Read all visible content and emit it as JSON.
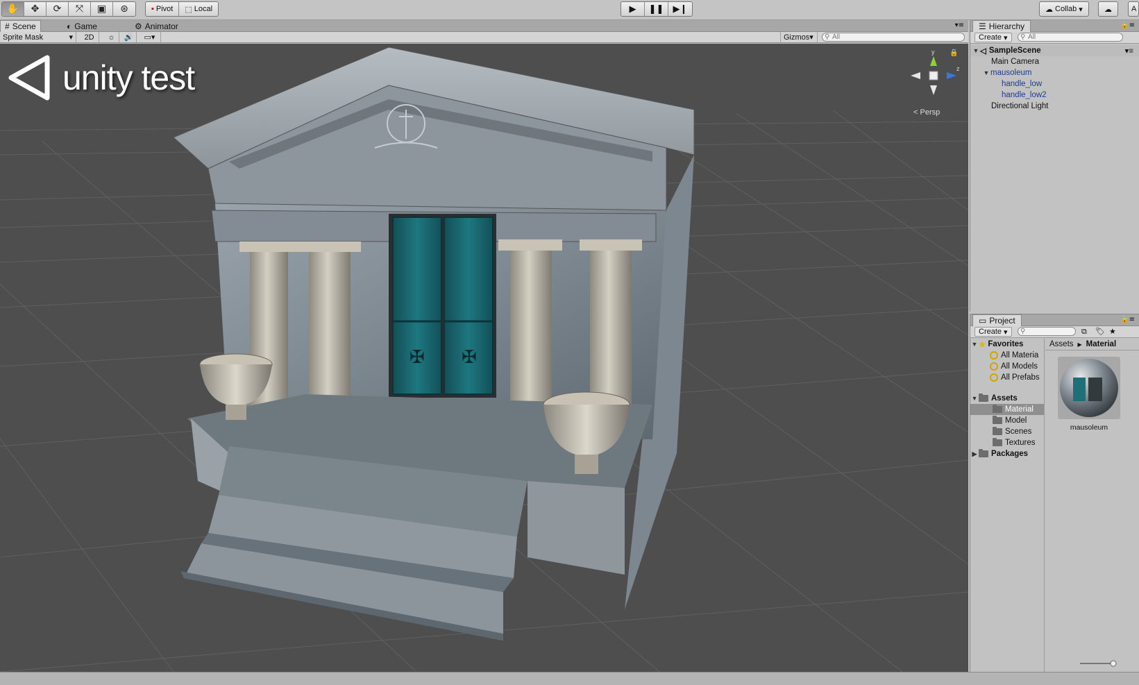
{
  "toolbar": {
    "pivot_label": "Pivot",
    "local_label": "Local",
    "collab_label": "Collab",
    "account_initial": "A"
  },
  "scene_panel": {
    "tabs": [
      {
        "label": "Scene"
      },
      {
        "label": "Game"
      },
      {
        "label": "Animator"
      }
    ],
    "draw_mode": "Sprite Mask",
    "mode_2d": "2D",
    "gizmos_label": "Gizmos",
    "search_placeholder": "All",
    "logo_text": "unity test",
    "gizmo_axes": {
      "y": "y",
      "z": "z"
    },
    "projection_label": "Persp"
  },
  "hierarchy": {
    "tab_label": "Hierarchy",
    "create_label": "Create",
    "search_placeholder": "All",
    "scene_name": "SampleScene",
    "items": [
      {
        "label": "Main Camera"
      },
      {
        "label": "mausoleum"
      },
      {
        "label": "handle_low"
      },
      {
        "label": "handle_low2"
      },
      {
        "label": "Directional Light"
      }
    ]
  },
  "project": {
    "tab_label": "Project",
    "create_label": "Create",
    "favorites_label": "Favorites",
    "favorites": [
      {
        "label": "All Materia"
      },
      {
        "label": "All Models"
      },
      {
        "label": "All Prefabs"
      }
    ],
    "assets_label": "Assets",
    "folders": [
      {
        "label": "Material"
      },
      {
        "label": "Model"
      },
      {
        "label": "Scenes"
      },
      {
        "label": "Textures"
      }
    ],
    "packages_label": "Packages",
    "breadcrumb": {
      "root": "Assets",
      "current": "Material"
    },
    "asset_name": "mausoleum"
  },
  "colors": {
    "viewport_bg": "#4e4e4e",
    "hierarchy_blue": "#1b3c8c",
    "door_teal": "#1e6f78"
  }
}
